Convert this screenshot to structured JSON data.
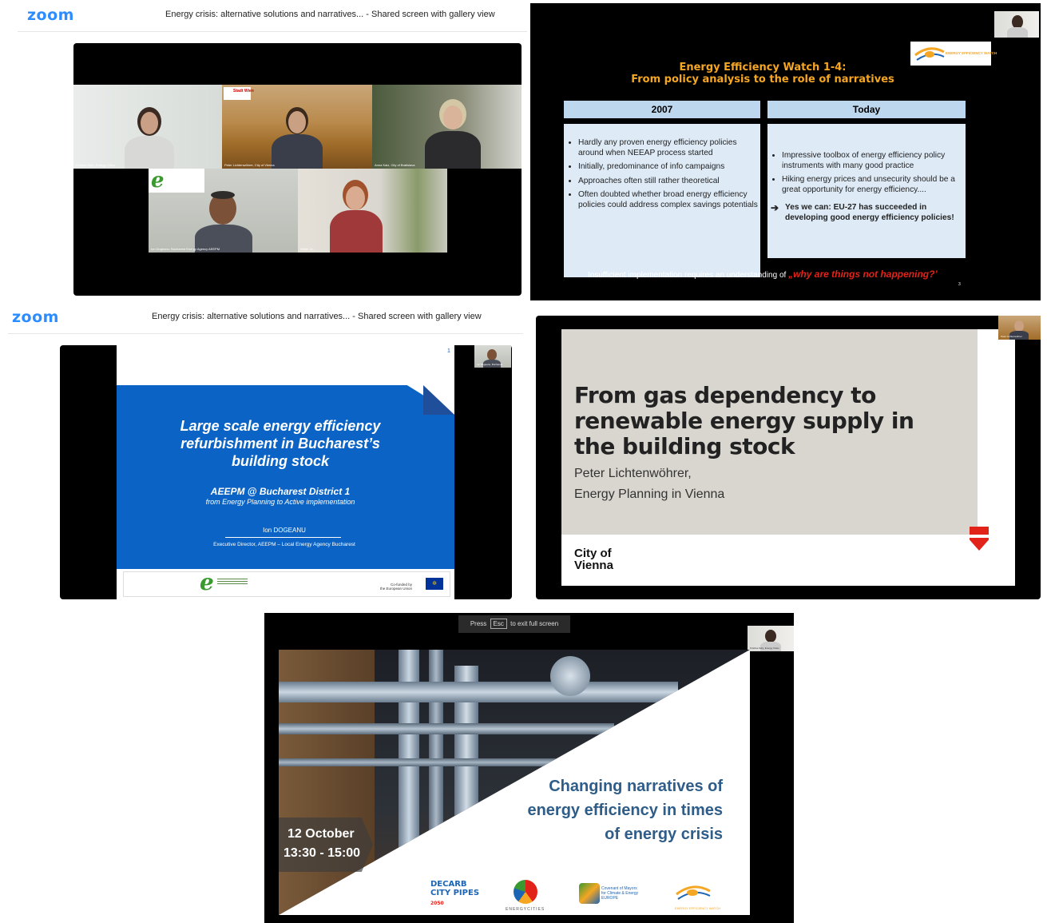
{
  "panel_top_left": {
    "brand": "zoom",
    "header_title": "Energy crisis: alternative solutions and narratives... - Shared screen with gallery view",
    "tiles": [
      {
        "label": "Kristina Kelly, Energy Cities"
      },
      {
        "label": "Peter Lichtenwöhrer, City of Vienna",
        "sign": "Stadt Wien"
      },
      {
        "label": "Anna Kaiz, City of Bratislava"
      },
      {
        "label": "Ion Dogeanu, Bucharest Energy Agency AEEPM"
      },
      {
        "label": "Heike Jo..."
      }
    ]
  },
  "panel_top_right": {
    "logo_text": "ENERGY EFFICIENCY WATCH",
    "title_line1": "Energy Efficiency Watch 1-4:",
    "title_line2": "From policy analysis to the role of narratives",
    "col_left_header": "2007",
    "col_right_header": "Today",
    "left_bullets": [
      "Hardly any proven energy efficiency policies around when NEEAP process started",
      "Initially, predominance of info campaigns",
      "Approaches often still rather theoretical",
      "Often doubted whether broad energy efficiency policies could address complex savings potentials"
    ],
    "right_bullets": [
      "Impressive toolbox of energy efficiency policy instruments with many good practice",
      "Hiking energy prices and unsecurity should be a great opportunity for energy efficiency...."
    ],
    "right_conclusion": "Yes we can: EU-27 has succeeded in developing good energy efficiency policies!",
    "footer_text": "Insufficient implementation requires an understanding of ",
    "footer_quote": "„why are things not happening?’",
    "page_number": "3"
  },
  "panel_mid_left": {
    "brand": "zoom",
    "header_title": "Energy crisis: alternative solutions and narratives... - Shared screen with gallery view",
    "slide_number": "1",
    "title": "Large scale energy efficiency refurbishment in Bucharest’s building stock",
    "subtitle": "AEEPM  @ Bucharest District 1",
    "subtitle2": "from Energy Planning to Active implementation",
    "author": "Ion DOGEANU",
    "role": "Executive Director, AEEPM – Local Energy Agency Bucharest",
    "eu_text_1": "Co-funded by",
    "eu_text_2": "the European Union",
    "thumb_label": "Ion Dogeanu, Bucharest"
  },
  "panel_mid_right": {
    "title": "From gas dependency to renewable energy supply in the building stock",
    "presenter": "Peter Lichtenwöhrer,",
    "org": "Energy Planning in Vienna",
    "city_line1": "City of",
    "city_line2": "Vienna",
    "thumb_label": "Peter Lichtenwöhrer"
  },
  "panel_bottom": {
    "toast_pre": "Press",
    "toast_key": "Esc",
    "toast_post": "to exit full screen",
    "title_line1": "Changing narratives of",
    "title_line2": "energy efficiency in times",
    "title_line3": "of energy crisis",
    "date": "12 October",
    "time": "13:30 - 15:00",
    "logos": [
      "DECARB CITY PIPES 2050",
      "ENERGY CITIES",
      "Covenant of Mayors for Climate & Energy EUROPE",
      "ENERGY EFFICIENCY WATCH"
    ],
    "thumb_label": "Kristina Kelly, Energy Cities"
  },
  "colors": {
    "zoom_blue": "#2D8CFF",
    "eew_orange": "#F5A623",
    "bucharest_blue": "#0B64C5",
    "vienna_red": "#E2231A",
    "quote_red": "#E2231A"
  }
}
